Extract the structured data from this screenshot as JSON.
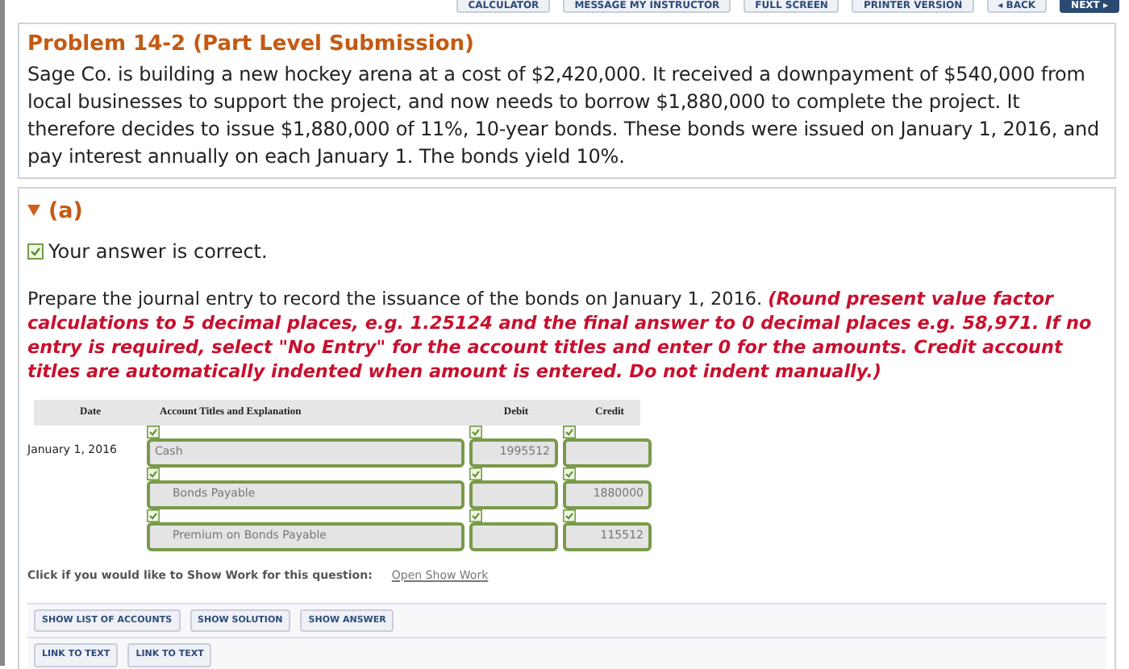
{
  "toolbar": [
    {
      "label": "CALCULATOR",
      "kind": "plain"
    },
    {
      "label": "MESSAGE MY INSTRUCTOR",
      "kind": "plain"
    },
    {
      "label": "FULL SCREEN",
      "kind": "plain"
    },
    {
      "label": "PRINTER VERSION",
      "kind": "plain"
    },
    {
      "label": "◂ BACK",
      "kind": "plain"
    },
    {
      "label": "NEXT ▸",
      "kind": "primary"
    }
  ],
  "problem": {
    "title": "Problem 14-2 (Part Level Submission)",
    "text": "Sage Co. is building a new hockey arena at a cost of $2,420,000. It received a downpayment of $540,000 from local businesses to support the project, and now needs to borrow $1,880,000 to complete the project. It therefore decides to issue $1,880,000 of 11%, 10-year bonds. These bonds were issued on January 1, 2016, and pay interest annually on each January 1. The bonds yield 10%."
  },
  "part": {
    "label": "(a)",
    "expanded": true,
    "status": "Your answer is correct.",
    "status_correct": true,
    "instruction": "Prepare the journal entry to record the issuance of the bonds on January 1, 2016.",
    "emphasis": "(Round present value factor calculations to 5 decimal places, e.g. 1.25124 and the final answer to 0 decimal places e.g. 58,971. If no entry is required, select \"No Entry\" for the account titles and enter 0 for the amounts. Credit account titles are automatically indented when amount is entered. Do not indent manually.)"
  },
  "journal": {
    "columns": [
      "Date",
      "Account Titles and Explanation",
      "Debit",
      "Credit"
    ],
    "rows": [
      {
        "date": "January 1, 2016",
        "account": "Cash",
        "indented": false,
        "debit": "1995512",
        "credit": "",
        "correct": true
      },
      {
        "date": "",
        "account": "Bonds Payable",
        "indented": true,
        "debit": "",
        "credit": "1880000",
        "correct": true
      },
      {
        "date": "",
        "account": "Premium on Bonds Payable",
        "indented": true,
        "debit": "",
        "credit": "115512",
        "correct": true
      }
    ]
  },
  "show_work": {
    "prompt": "Click if you would like to Show Work for this question:",
    "link": "Open Show Work"
  },
  "action_rows": [
    [
      "SHOW LIST OF ACCOUNTS",
      "SHOW SOLUTION",
      "SHOW ANSWER"
    ],
    [
      "LINK TO TEXT",
      "LINK TO TEXT"
    ]
  ]
}
